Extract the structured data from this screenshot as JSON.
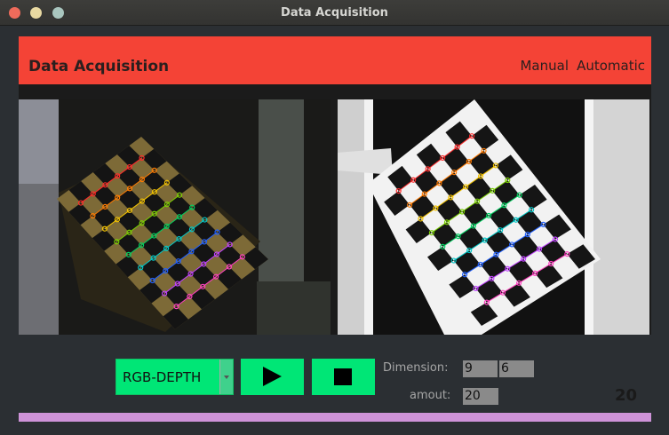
{
  "window": {
    "title": "Data Acquisition"
  },
  "header": {
    "title": "Data Acquisition",
    "nav": [
      "Manual",
      "Automatic"
    ]
  },
  "views": {
    "rgb": {
      "icon": "rgb-camera-feed"
    },
    "depth": {
      "icon": "depth-camera-feed"
    }
  },
  "controls": {
    "mode_select": {
      "value": "RGB-DEPTH"
    },
    "play_icon": "play-icon",
    "stop_icon": "stop-icon",
    "dimension_label": "Dimension:",
    "dimension_values": [
      "9",
      "6"
    ],
    "amount_label": "amout:",
    "amount_value": "20",
    "captured_count": "20"
  },
  "progress": {
    "value": 1.0,
    "color": "#ce93d8"
  },
  "colors": {
    "header": "#f44336",
    "accent_green": "#00e676"
  }
}
